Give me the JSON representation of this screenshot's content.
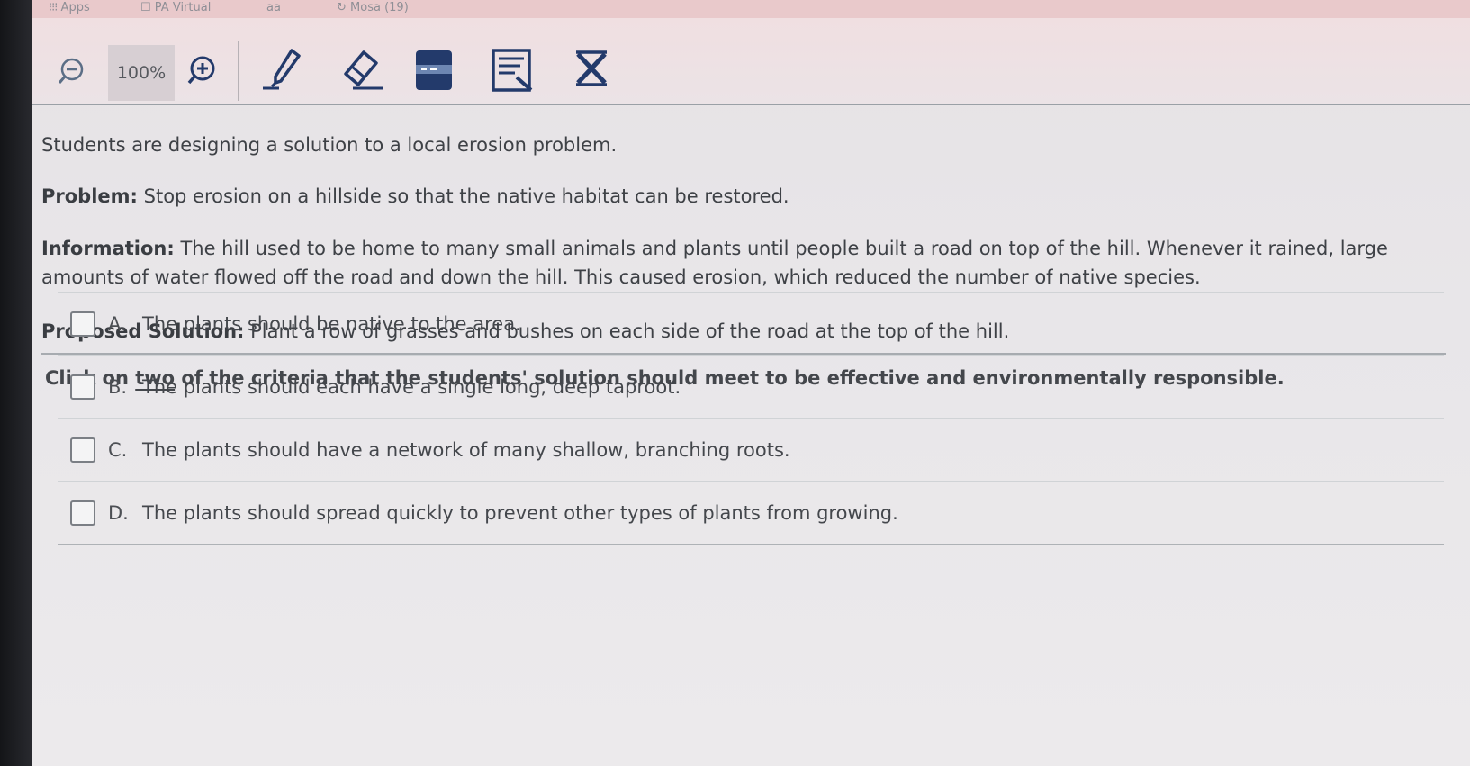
{
  "bookmarks": {
    "apps_label": "Apps",
    "item2_label": "PA Virtual",
    "item3_label": "aa",
    "item4_label": "Mosa (19)"
  },
  "toolbar": {
    "zoom_value": "100%"
  },
  "passage": {
    "intro": "Students are designing a solution to a local erosion problem.",
    "problem_label": "Problem:",
    "problem_text": "Stop erosion on a hillside so that the native habitat can be restored.",
    "information_label": "Information:",
    "information_text": "The hill used to be home to many small animals and plants until people built a road on top of the hill. Whenever it rained, large amounts of water flowed off the road and down the hill. This caused erosion, which reduced the number of native species.",
    "solution_label": "Proposed Solution:",
    "solution_text": "Plant a row of grasses and bushes on each side of the road at the top of the hill."
  },
  "question": {
    "prompt_before": "Click on ",
    "prompt_emphasis": "two",
    "prompt_after": " of the criteria that the students' solution should meet to be effective and environmentally responsible.",
    "choices": [
      {
        "letter": "A.",
        "text": "The plants should be native to the area."
      },
      {
        "letter": "B.",
        "text": "The plants should each have a single long, deep taproot."
      },
      {
        "letter": "C.",
        "text": "The plants should have a network of many shallow, branching roots."
      },
      {
        "letter": "D.",
        "text": "The plants should spread quickly to prevent other types of plants from growing."
      }
    ]
  },
  "icons": {
    "zoom_out": "zoom-out-icon",
    "zoom_in": "zoom-in-icon",
    "pen": "pen-icon",
    "eraser": "eraser-icon",
    "line_reader": "line-reader-icon",
    "notepad": "notepad-icon",
    "answer_eliminator": "answer-eliminator-icon"
  },
  "colors": {
    "bookmark_bar": "#e9c9cb",
    "toolbar_bg": "#f0dfe1",
    "icon_navy": "#233a6b",
    "text": "#3e4146"
  }
}
